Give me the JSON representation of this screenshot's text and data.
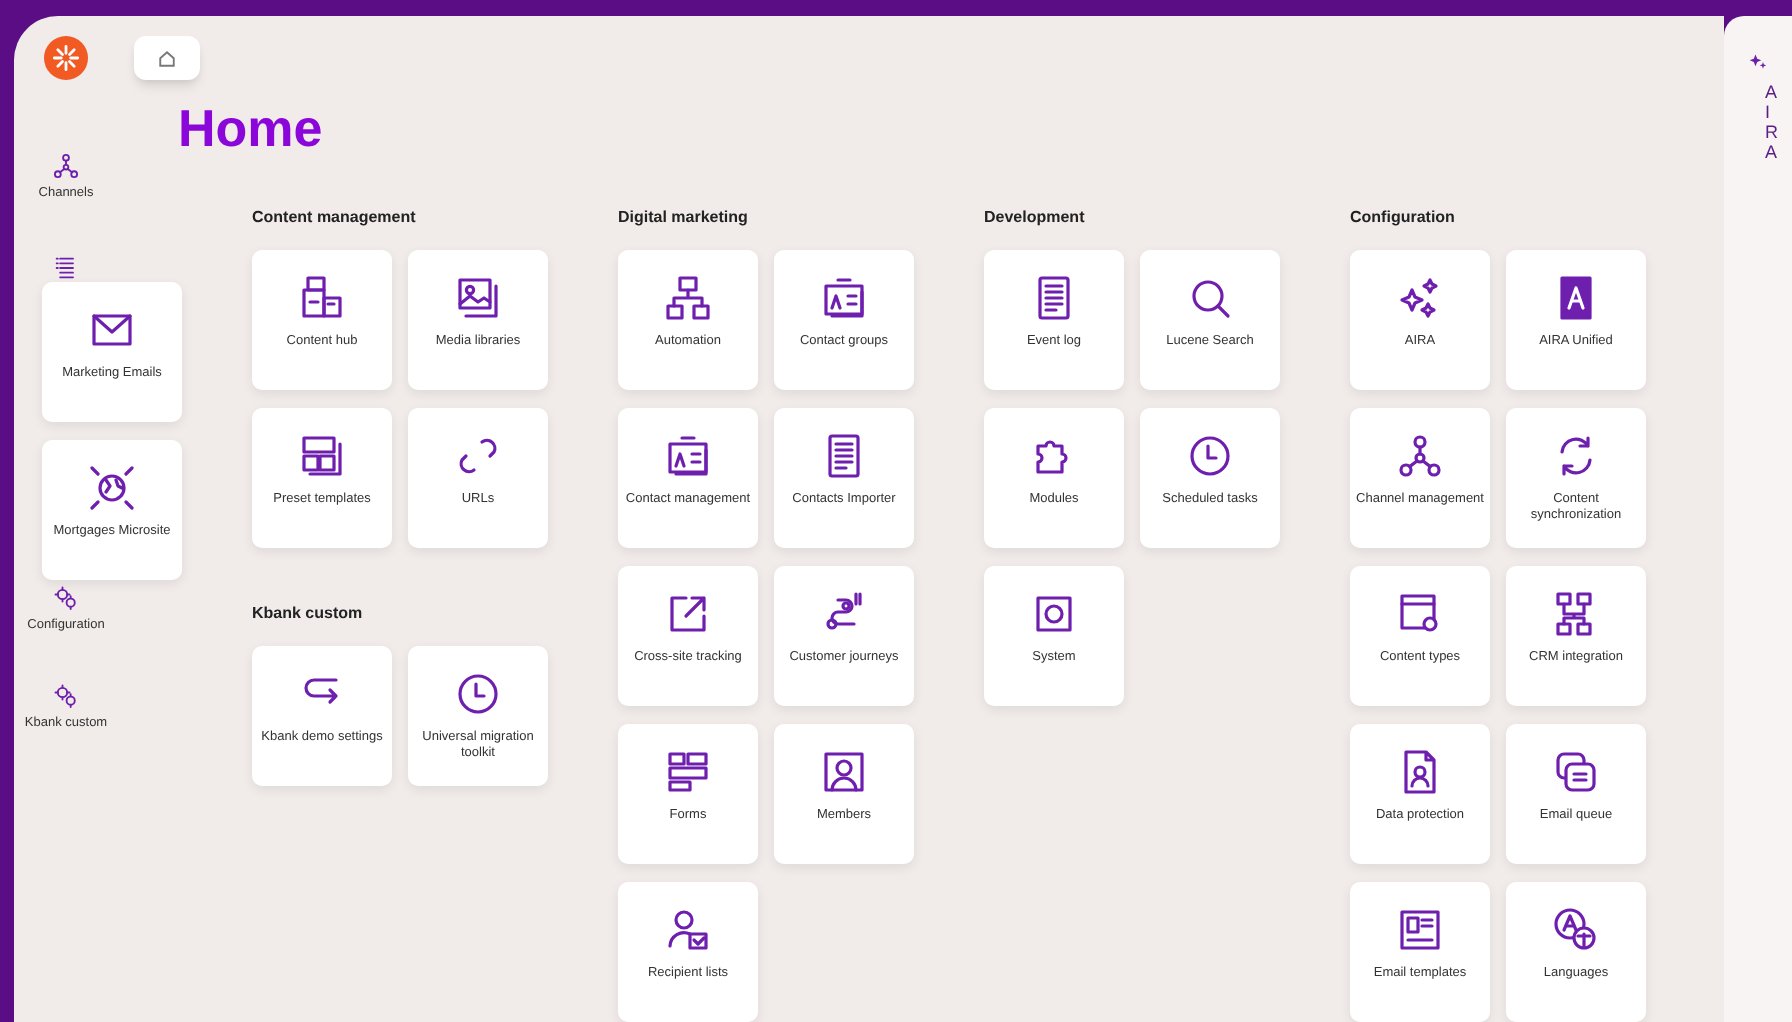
{
  "sidebar": {
    "items": [
      {
        "label": "Channels"
      },
      {
        "label": "Configuration"
      },
      {
        "label": "Kbank custom"
      }
    ]
  },
  "flyout": {
    "tiles": [
      "Marketing Emails",
      "Mortgages Microsite"
    ]
  },
  "page": {
    "title": "Home"
  },
  "columns": [
    {
      "sections": [
        {
          "title": "Content management",
          "tiles": [
            "Content hub",
            "Media libraries",
            "Preset templates",
            "URLs"
          ]
        },
        {
          "title": "Kbank custom",
          "tiles": [
            "Kbank demo settings",
            "Universal migration toolkit"
          ]
        }
      ]
    },
    {
      "sections": [
        {
          "title": "Digital marketing",
          "tiles": [
            "Automation",
            "Contact groups",
            "Contact management",
            "Contacts Importer",
            "Cross-site tracking",
            "Customer journeys",
            "Forms",
            "Members",
            "Recipient lists"
          ]
        }
      ]
    },
    {
      "sections": [
        {
          "title": "Development",
          "tiles": [
            "Event log",
            "Lucene Search",
            "Modules",
            "Scheduled tasks",
            "System"
          ]
        }
      ]
    },
    {
      "sections": [
        {
          "title": "Configuration",
          "tiles": [
            "AIRA",
            "AIRA Unified",
            "Channel management",
            "Content synchronization",
            "Content types",
            "CRM integration",
            "Data protection",
            "Email queue",
            "Email templates",
            "Languages"
          ]
        }
      ]
    }
  ],
  "side_panel": {
    "title": "AIRA"
  }
}
